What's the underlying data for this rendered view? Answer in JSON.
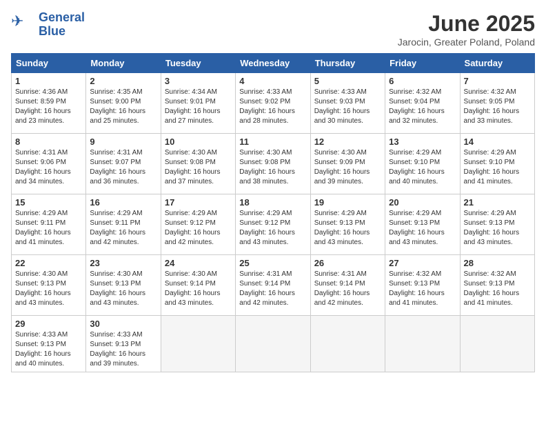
{
  "header": {
    "logo_line1": "General",
    "logo_line2": "Blue",
    "month": "June 2025",
    "location": "Jarocin, Greater Poland, Poland"
  },
  "weekdays": [
    "Sunday",
    "Monday",
    "Tuesday",
    "Wednesday",
    "Thursday",
    "Friday",
    "Saturday"
  ],
  "weeks": [
    [
      {
        "day": "1",
        "info": "Sunrise: 4:36 AM\nSunset: 8:59 PM\nDaylight: 16 hours\nand 23 minutes."
      },
      {
        "day": "2",
        "info": "Sunrise: 4:35 AM\nSunset: 9:00 PM\nDaylight: 16 hours\nand 25 minutes."
      },
      {
        "day": "3",
        "info": "Sunrise: 4:34 AM\nSunset: 9:01 PM\nDaylight: 16 hours\nand 27 minutes."
      },
      {
        "day": "4",
        "info": "Sunrise: 4:33 AM\nSunset: 9:02 PM\nDaylight: 16 hours\nand 28 minutes."
      },
      {
        "day": "5",
        "info": "Sunrise: 4:33 AM\nSunset: 9:03 PM\nDaylight: 16 hours\nand 30 minutes."
      },
      {
        "day": "6",
        "info": "Sunrise: 4:32 AM\nSunset: 9:04 PM\nDaylight: 16 hours\nand 32 minutes."
      },
      {
        "day": "7",
        "info": "Sunrise: 4:32 AM\nSunset: 9:05 PM\nDaylight: 16 hours\nand 33 minutes."
      }
    ],
    [
      {
        "day": "8",
        "info": "Sunrise: 4:31 AM\nSunset: 9:06 PM\nDaylight: 16 hours\nand 34 minutes."
      },
      {
        "day": "9",
        "info": "Sunrise: 4:31 AM\nSunset: 9:07 PM\nDaylight: 16 hours\nand 36 minutes."
      },
      {
        "day": "10",
        "info": "Sunrise: 4:30 AM\nSunset: 9:08 PM\nDaylight: 16 hours\nand 37 minutes."
      },
      {
        "day": "11",
        "info": "Sunrise: 4:30 AM\nSunset: 9:08 PM\nDaylight: 16 hours\nand 38 minutes."
      },
      {
        "day": "12",
        "info": "Sunrise: 4:30 AM\nSunset: 9:09 PM\nDaylight: 16 hours\nand 39 minutes."
      },
      {
        "day": "13",
        "info": "Sunrise: 4:29 AM\nSunset: 9:10 PM\nDaylight: 16 hours\nand 40 minutes."
      },
      {
        "day": "14",
        "info": "Sunrise: 4:29 AM\nSunset: 9:10 PM\nDaylight: 16 hours\nand 41 minutes."
      }
    ],
    [
      {
        "day": "15",
        "info": "Sunrise: 4:29 AM\nSunset: 9:11 PM\nDaylight: 16 hours\nand 41 minutes."
      },
      {
        "day": "16",
        "info": "Sunrise: 4:29 AM\nSunset: 9:11 PM\nDaylight: 16 hours\nand 42 minutes."
      },
      {
        "day": "17",
        "info": "Sunrise: 4:29 AM\nSunset: 9:12 PM\nDaylight: 16 hours\nand 42 minutes."
      },
      {
        "day": "18",
        "info": "Sunrise: 4:29 AM\nSunset: 9:12 PM\nDaylight: 16 hours\nand 43 minutes."
      },
      {
        "day": "19",
        "info": "Sunrise: 4:29 AM\nSunset: 9:13 PM\nDaylight: 16 hours\nand 43 minutes."
      },
      {
        "day": "20",
        "info": "Sunrise: 4:29 AM\nSunset: 9:13 PM\nDaylight: 16 hours\nand 43 minutes."
      },
      {
        "day": "21",
        "info": "Sunrise: 4:29 AM\nSunset: 9:13 PM\nDaylight: 16 hours\nand 43 minutes."
      }
    ],
    [
      {
        "day": "22",
        "info": "Sunrise: 4:30 AM\nSunset: 9:13 PM\nDaylight: 16 hours\nand 43 minutes."
      },
      {
        "day": "23",
        "info": "Sunrise: 4:30 AM\nSunset: 9:13 PM\nDaylight: 16 hours\nand 43 minutes."
      },
      {
        "day": "24",
        "info": "Sunrise: 4:30 AM\nSunset: 9:14 PM\nDaylight: 16 hours\nand 43 minutes."
      },
      {
        "day": "25",
        "info": "Sunrise: 4:31 AM\nSunset: 9:14 PM\nDaylight: 16 hours\nand 42 minutes."
      },
      {
        "day": "26",
        "info": "Sunrise: 4:31 AM\nSunset: 9:14 PM\nDaylight: 16 hours\nand 42 minutes."
      },
      {
        "day": "27",
        "info": "Sunrise: 4:32 AM\nSunset: 9:13 PM\nDaylight: 16 hours\nand 41 minutes."
      },
      {
        "day": "28",
        "info": "Sunrise: 4:32 AM\nSunset: 9:13 PM\nDaylight: 16 hours\nand 41 minutes."
      }
    ],
    [
      {
        "day": "29",
        "info": "Sunrise: 4:33 AM\nSunset: 9:13 PM\nDaylight: 16 hours\nand 40 minutes."
      },
      {
        "day": "30",
        "info": "Sunrise: 4:33 AM\nSunset: 9:13 PM\nDaylight: 16 hours\nand 39 minutes."
      },
      {
        "day": "",
        "info": ""
      },
      {
        "day": "",
        "info": ""
      },
      {
        "day": "",
        "info": ""
      },
      {
        "day": "",
        "info": ""
      },
      {
        "day": "",
        "info": ""
      }
    ]
  ]
}
